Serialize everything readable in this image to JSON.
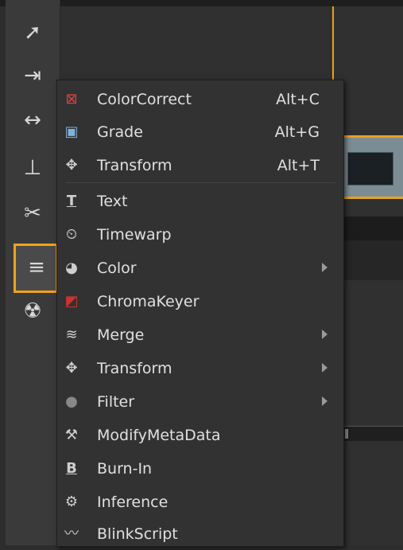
{
  "menu": {
    "items": [
      {
        "label": "ColorCorrect",
        "shortcut": "Alt+C",
        "icon": "colorcorrect-icon",
        "submenu": false
      },
      {
        "label": "Grade",
        "shortcut": "Alt+G",
        "icon": "grade-icon",
        "submenu": false
      },
      {
        "label": "Transform",
        "shortcut": "Alt+T",
        "icon": "transform-icon",
        "submenu": false
      },
      {
        "label": "Text",
        "shortcut": "",
        "icon": "text-icon",
        "submenu": false
      },
      {
        "label": "Timewarp",
        "shortcut": "",
        "icon": "timewarp-icon",
        "submenu": false
      },
      {
        "label": "Color",
        "shortcut": "",
        "icon": "color-icon",
        "submenu": true
      },
      {
        "label": "ChromaKeyer",
        "shortcut": "",
        "icon": "chromakeyer-icon",
        "submenu": false
      },
      {
        "label": "Merge",
        "shortcut": "",
        "icon": "merge-icon",
        "submenu": true
      },
      {
        "label": "Transform",
        "shortcut": "",
        "icon": "transform-icon",
        "submenu": true
      },
      {
        "label": "Filter",
        "shortcut": "",
        "icon": "filter-icon",
        "submenu": true
      },
      {
        "label": "ModifyMetaData",
        "shortcut": "",
        "icon": "modifymetadata-icon",
        "submenu": false
      },
      {
        "label": "Burn-In",
        "shortcut": "",
        "icon": "burn-in-icon",
        "submenu": false
      },
      {
        "label": "Inference",
        "shortcut": "",
        "icon": "inference-icon",
        "submenu": false
      },
      {
        "label": "BlinkScript",
        "shortcut": "",
        "icon": "blinkscript-icon",
        "submenu": false
      }
    ]
  },
  "colors": {
    "accent": "#f0a21c",
    "menu_bg": "#323232",
    "toolbar_bg": "#3a3a3a"
  }
}
